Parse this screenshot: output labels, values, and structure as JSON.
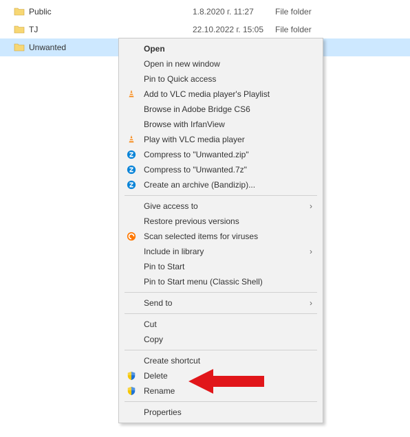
{
  "file_list": {
    "rows": [
      {
        "name": "Public",
        "date": "1.8.2020 г. 11:27",
        "type": "File folder",
        "selected": false
      },
      {
        "name": "TJ",
        "date": "22.10.2022 г. 15:05",
        "type": "File folder",
        "selected": false
      },
      {
        "name": "Unwanted",
        "date": "",
        "type": "",
        "selected": true
      }
    ]
  },
  "menu": {
    "open": "Open",
    "open_new_window": "Open in new window",
    "pin_quick": "Pin to Quick access",
    "vlc_add": "Add to VLC media player's Playlist",
    "bridge": "Browse in Adobe Bridge CS6",
    "irfan": "Browse with IrfanView",
    "vlc_play": "Play with VLC media player",
    "comp_zip": "Compress to \"Unwanted.zip\"",
    "comp_7z": "Compress to \"Unwanted.7z\"",
    "bandizip": "Create an archive (Bandizip)...",
    "give_access": "Give access to",
    "restore_prev": "Restore previous versions",
    "scan_virus": "Scan selected items for viruses",
    "include_lib": "Include in library",
    "pin_start": "Pin to Start",
    "pin_start_classic": "Pin to Start menu (Classic Shell)",
    "send_to": "Send to",
    "cut": "Cut",
    "copy": "Copy",
    "create_shortcut": "Create shortcut",
    "delete": "Delete",
    "rename": "Rename",
    "properties": "Properties"
  },
  "chevron": "›"
}
